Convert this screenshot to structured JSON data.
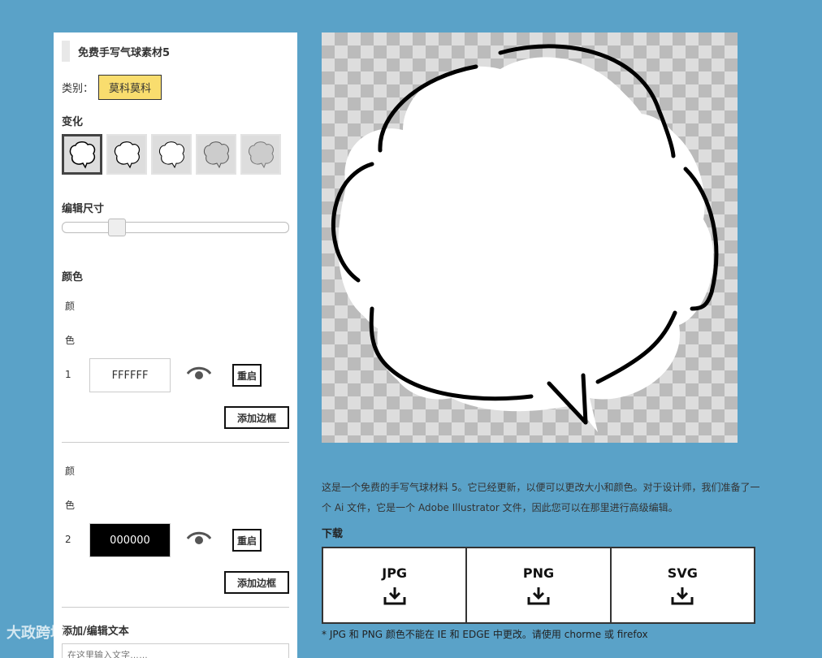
{
  "panel": {
    "title": "免费手写气球素材5",
    "category_label": "类别：",
    "category_value": "莫科莫科",
    "variant_label": "变化",
    "size_label": "编辑尺寸",
    "size_value": 0.22,
    "color_label": "颜色",
    "colors": [
      {
        "label_chars": [
          "颜",
          "色",
          "1"
        ],
        "value": "FFFFFF",
        "swatch": "#ffffff",
        "text_color": "#333333"
      },
      {
        "label_chars": [
          "颜",
          "色",
          "2"
        ],
        "value": "000000",
        "swatch": "#000000",
        "text_color": "#ffffff"
      }
    ],
    "reset_label": "重启",
    "add_border_label": "添加边框",
    "text_label": "添加/编辑文本",
    "text_placeholder": "在这里输入文字……"
  },
  "description": "这是一个免费的手写气球材料 5。它已经更新，以便可以更改大小和颜色。对于设计师，我们准备了一个 Ai 文件，它是一个 Adobe Illustrator 文件，因此您可以在那里进行高级编辑。",
  "download_label": "下载",
  "downloads": [
    {
      "label": "JPG",
      "icon": "download-icon"
    },
    {
      "label": "PNG",
      "icon": "download-icon"
    },
    {
      "label": "SVG",
      "icon": "download-icon"
    }
  ],
  "note": "* JPG 和 PNG 颜色不能在 IE 和 EDGE 中更改。请使用 chorme 或 firefox",
  "watermark": "大政跨境",
  "colors": {
    "background": "#5aa2c8",
    "badge": "#f9dd6e"
  }
}
